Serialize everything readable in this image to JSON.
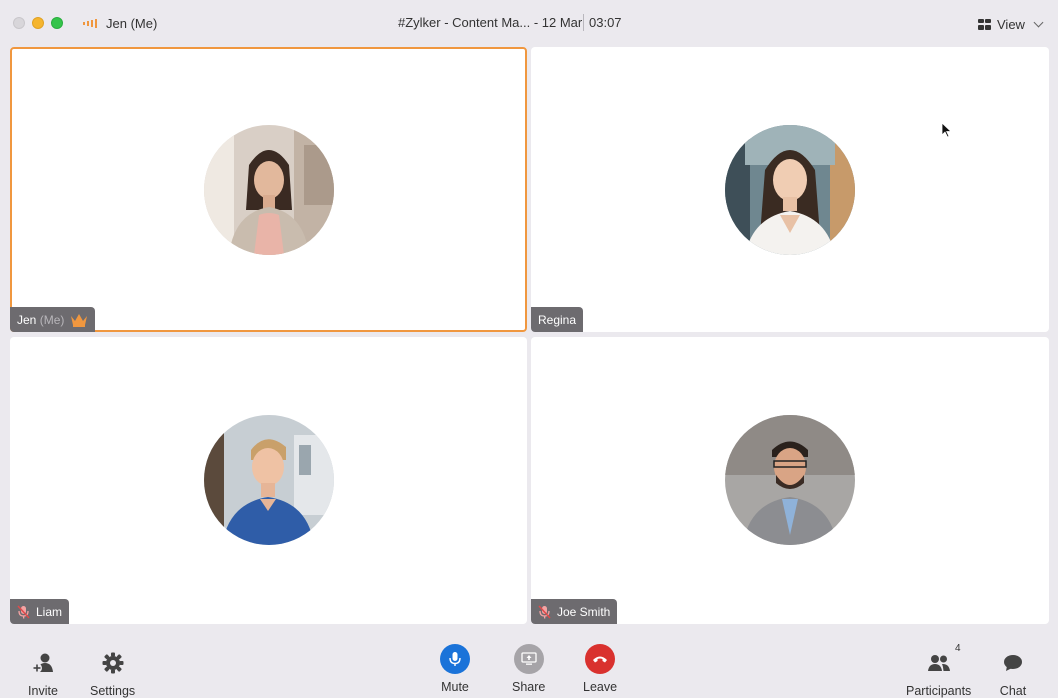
{
  "titlebar": {
    "me_label": "Jen (Me)",
    "meeting_title": "#Zylker - Content Ma... - 12 Mar",
    "timer": "03:07",
    "view_label": "View"
  },
  "tiles": [
    {
      "name": "Jen",
      "suffix": "(Me)",
      "host": true,
      "muted": false,
      "active": true
    },
    {
      "name": "Regina",
      "muted": false,
      "active": false
    },
    {
      "name": "Liam",
      "muted": true,
      "active": false
    },
    {
      "name": "Joe Smith",
      "muted": true,
      "active": false
    }
  ],
  "toolbar": {
    "invite_label": "Invite",
    "settings_label": "Settings",
    "mute_label": "Mute",
    "share_label": "Share",
    "leave_label": "Leave",
    "participants_label": "Participants",
    "participants_count": "4",
    "chat_label": "Chat"
  },
  "colors": {
    "active_border": "#f0973f",
    "mute_button": "#1a73d9",
    "share_button": "#a6a4a8",
    "leave_button": "#d9312e",
    "nametag_bg": "#6d6b6f",
    "crown": "#f0973f"
  }
}
